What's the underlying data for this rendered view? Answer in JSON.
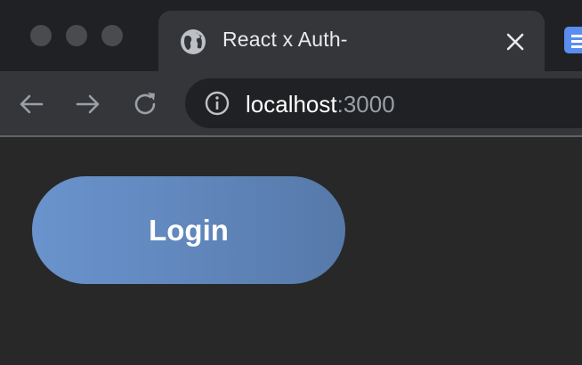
{
  "window": {
    "controls": [
      "close",
      "minimize",
      "maximize"
    ]
  },
  "tab": {
    "title": "React x Auth-",
    "icon": "globe-icon",
    "close_icon": "close-icon"
  },
  "toolbar": {
    "back_icon": "arrow-left-icon",
    "forward_icon": "arrow-right-icon",
    "reload_icon": "reload-icon",
    "site_info_icon": "info-icon",
    "url_host": "localhost",
    "url_port": ":3000"
  },
  "page": {
    "login_label": "Login"
  },
  "colors": {
    "tabstrip_bg": "#202124",
    "toolbar_bg": "#35363a",
    "page_bg": "#282828",
    "button_gradient_start": "#6a93cc",
    "button_gradient_end": "#5679a8",
    "next_tab_accent": "#5b8def"
  }
}
